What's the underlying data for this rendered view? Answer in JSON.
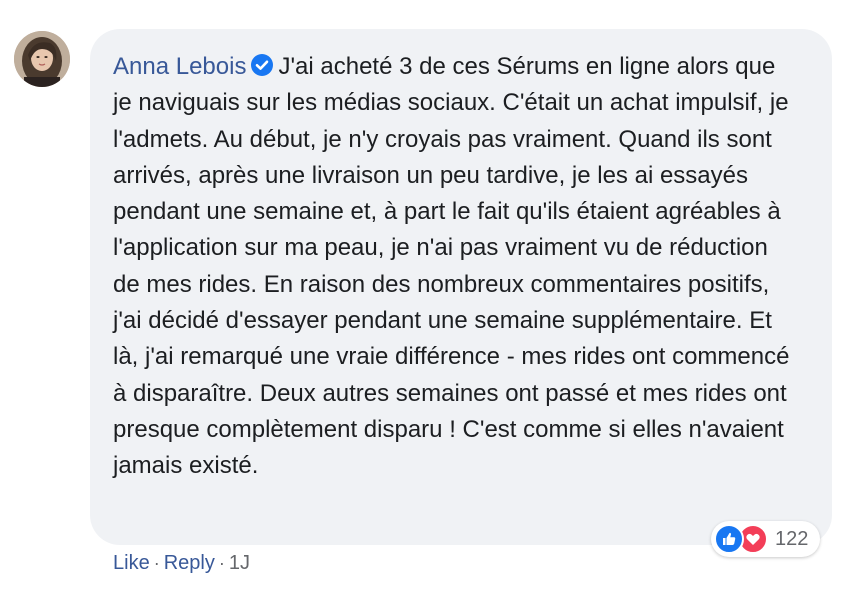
{
  "comment": {
    "author": "Anna Lebois",
    "text": "J'ai acheté 3 de ces Sérums en ligne alors que je naviguais sur les médias sociaux. C'était un achat impulsif, je l'admets. Au début, je n'y croyais pas vraiment. Quand ils sont arrivés, après une livraison un peu tardive, je les ai essayés pendant une semaine et, à part le fait qu'ils étaient agréables à l'application sur ma peau, je n'ai pas vraiment vu de réduction de mes rides. En raison des nombreux commentaires positifs, j'ai décidé d'essayer pendant une semaine supplémentaire. Et là, j'ai remarqué une vraie différence - mes rides ont commencé à disparaître. Deux autres semaines ont passé et mes rides ont presque complètement disparu ! C'est comme si elles n'avaient jamais existé.",
    "verified_icon": "verified-badge-icon",
    "reactions": {
      "icons": [
        "like-icon",
        "love-icon"
      ],
      "count": "122"
    },
    "actions": {
      "like_label": "Like",
      "reply_label": "Reply",
      "separator": "·",
      "timestamp": "1J"
    }
  },
  "colors": {
    "name": "#385898",
    "bubble": "#f0f2f5",
    "text": "#1c1e21",
    "like": "#1877f2",
    "love": "#f33e58",
    "verified": "#1877f2"
  }
}
